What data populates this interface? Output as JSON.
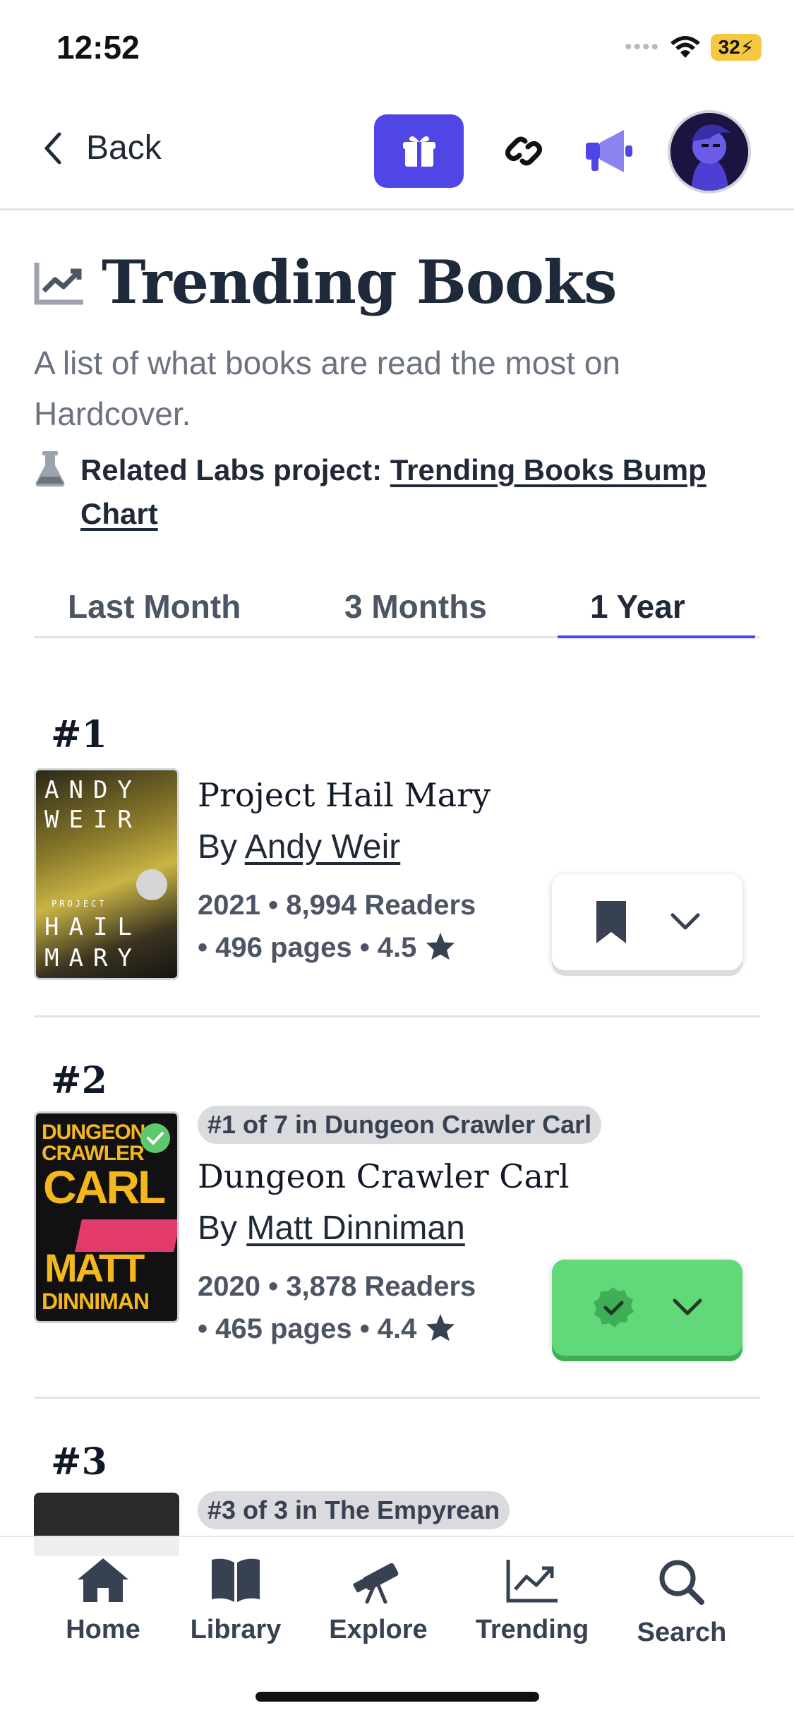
{
  "status_bar": {
    "time": "12:52",
    "battery": "32"
  },
  "nav": {
    "back_label": "Back"
  },
  "header": {
    "title": "Trending Books",
    "subtitle": "A list of what books are read the most on Hardcover.",
    "labs_prefix": "Related Labs project:",
    "labs_link": "Trending Books Bump Chart"
  },
  "tabs": [
    {
      "label": "Last Month",
      "active": false
    },
    {
      "label": "3 Months",
      "active": false
    },
    {
      "label": "1 Year",
      "active": true
    }
  ],
  "books": [
    {
      "rank": "#1",
      "cover_lines": [
        "ANDY",
        "WEIR",
        "PROJECT",
        "HAIL",
        "MARY"
      ],
      "series": "",
      "title": "Project Hail Mary",
      "by": "By",
      "author": "Andy Weir",
      "meta_line1": "2021 • 8,994 Readers",
      "meta_line2": "• 496 pages • 4.5",
      "status": "want-to-read"
    },
    {
      "rank": "#2",
      "cover_lines": [
        "DUNGEON",
        "CRAWLER",
        "CARL",
        "MATT",
        "DINNIMAN"
      ],
      "series": "#1 of 7 in Dungeon Crawler Carl",
      "title": "Dungeon Crawler Carl",
      "by": "By",
      "author": "Matt Dinniman",
      "meta_line1": "2020 • 3,878 Readers",
      "meta_line2": "• 465 pages • 4.4",
      "status": "read"
    },
    {
      "rank": "#3",
      "series": "#3 of 3 in The Empyrean"
    }
  ],
  "bottom_nav": [
    {
      "label": "Home",
      "icon": "home-icon"
    },
    {
      "label": "Library",
      "icon": "book-icon"
    },
    {
      "label": "Explore",
      "icon": "telescope-icon"
    },
    {
      "label": "Trending",
      "icon": "trending-icon"
    },
    {
      "label": "Search",
      "icon": "search-icon"
    }
  ],
  "colors": {
    "accent": "#5046e5",
    "read_green": "#62d979",
    "text": "#1f2937",
    "muted": "#6b7280"
  }
}
